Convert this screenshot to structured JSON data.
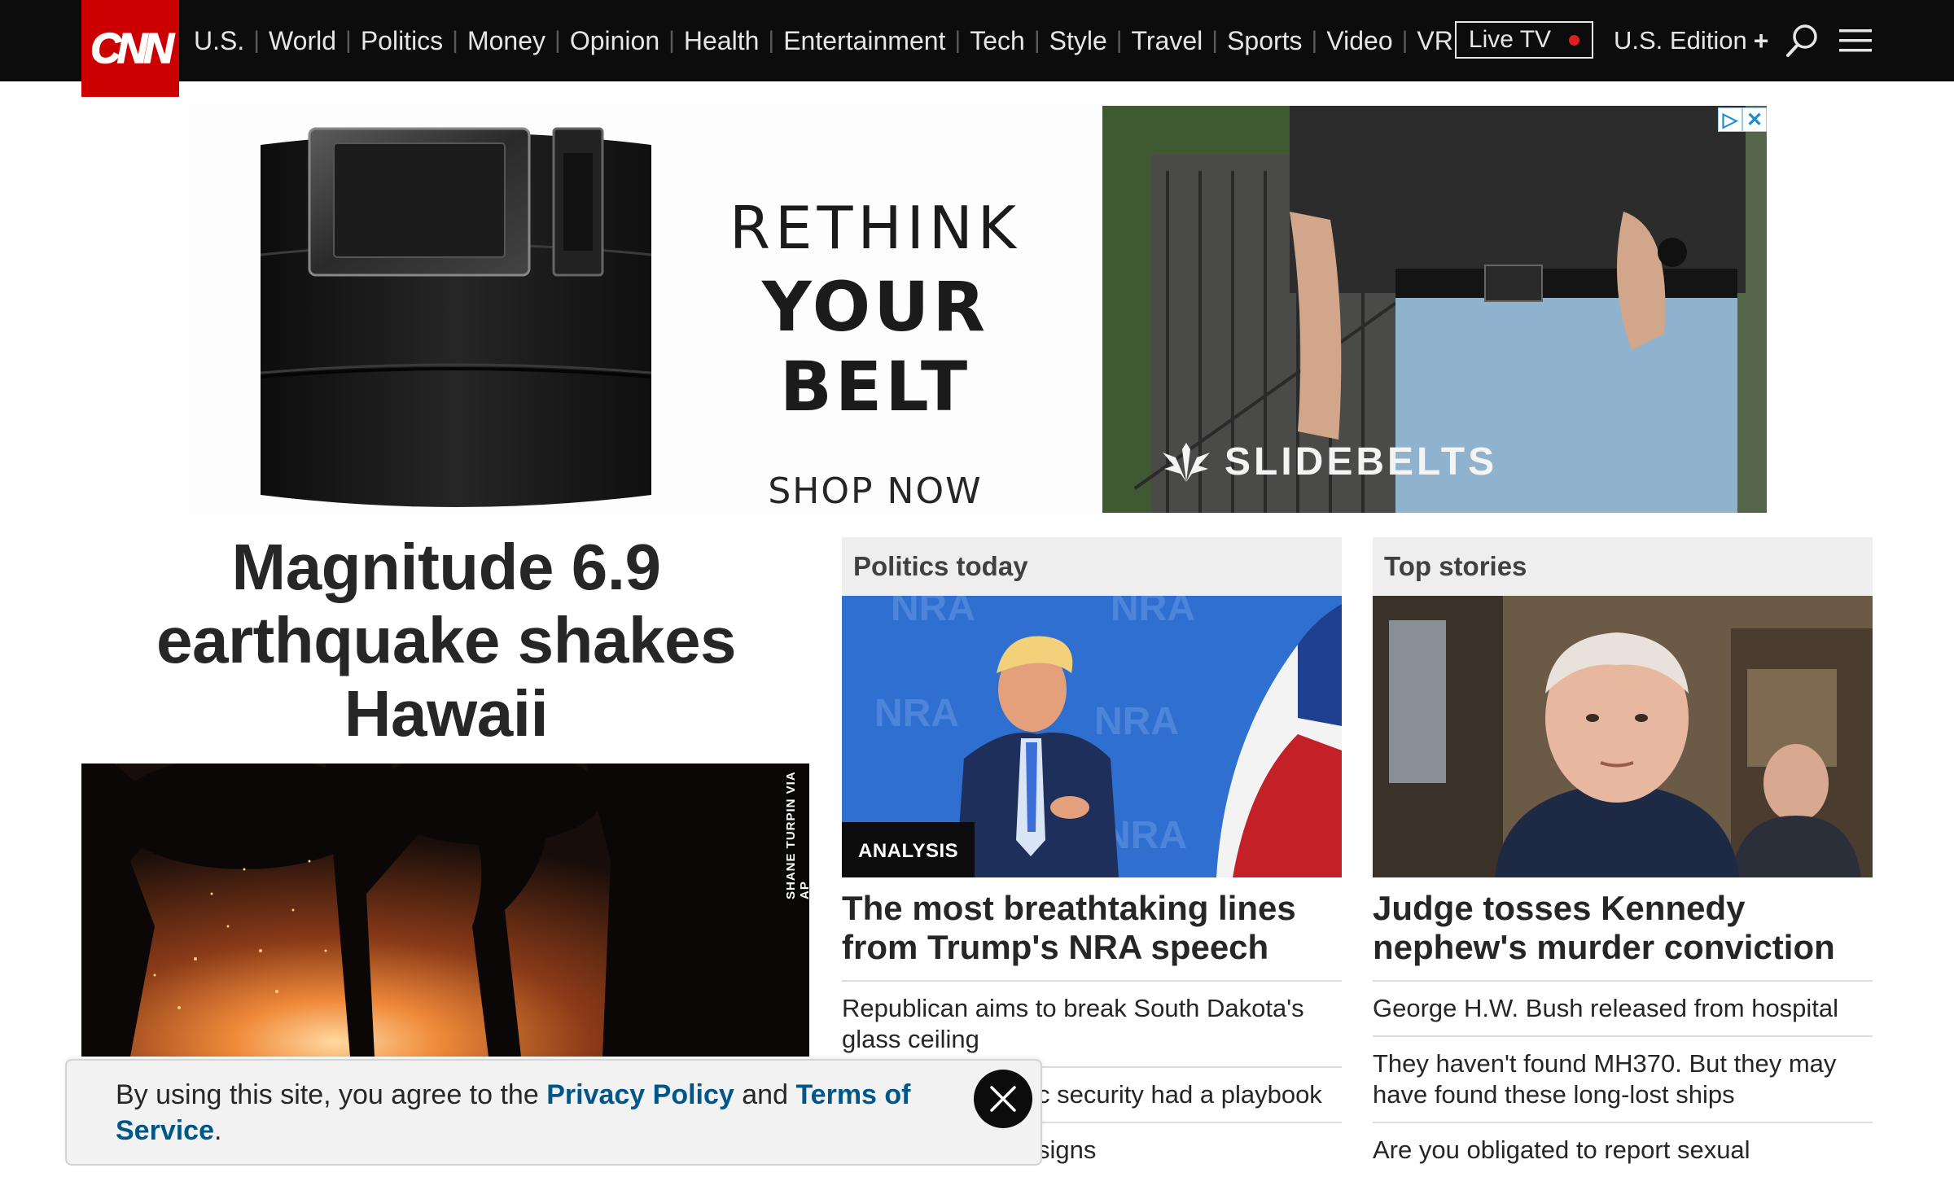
{
  "header": {
    "logo_text": "CNN",
    "nav_items": [
      "U.S.",
      "World",
      "Politics",
      "Money",
      "Opinion",
      "Health",
      "Entertainment",
      "Tech",
      "Style",
      "Travel",
      "Sports",
      "Video",
      "VR"
    ],
    "live_tv_label": "Live TV",
    "edition_label": "U.S. Edition",
    "edition_plus": "+",
    "icons": [
      "search-icon",
      "menu-icon"
    ]
  },
  "ad": {
    "line1": "RETHINK",
    "line2": "YOUR BELT",
    "cta": "SHOP NOW",
    "brand": "SLIDEBELTS",
    "adchoices_icon": "▷",
    "close_icon": "✕"
  },
  "lead": {
    "headline": "Magnitude 6.9 earthquake shakes Hawaii",
    "photo_credit": "SHANE TURPIN VIA AP"
  },
  "politics": {
    "section_title": "Politics today",
    "badge": "ANALYSIS",
    "headline": "The most breathtaking lines from Trump's NRA speech",
    "items": [
      "Republican aims to break South Dakota's glass ceiling",
      "c security had a playbook",
      "signs"
    ]
  },
  "top_stories": {
    "section_title": "Top stories",
    "headline": "Judge tosses Kennedy nephew's murder conviction",
    "items": [
      "George H.W. Bush released from hospital",
      "They haven't found MH370. But they may have found these long-lost ships",
      "Are you obligated to report sexual"
    ]
  },
  "cookie_banner": {
    "text_before": "By using this site, you agree to the ",
    "privacy_link": "Privacy Policy",
    "text_middle": " and ",
    "terms_link": "Terms of Service",
    "text_after": "."
  },
  "colors": {
    "nav_bg": "#0c0c0c",
    "brand_red": "#cc0000",
    "link_blue": "#005689",
    "live_dot": "#e11d1d"
  }
}
